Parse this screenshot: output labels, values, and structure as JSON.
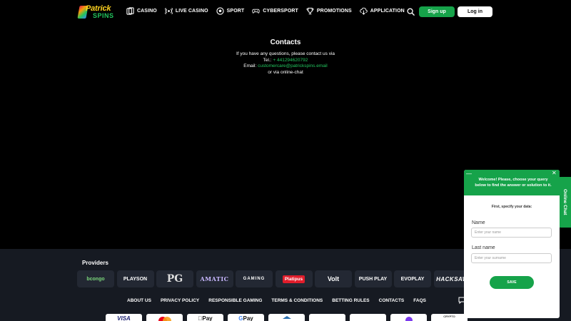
{
  "header": {
    "logo_line1": "Patrick",
    "logo_line2": "SPINS",
    "nav": [
      {
        "label": "CASINO",
        "icon": "cards-icon"
      },
      {
        "label": "LIVE CASINO",
        "icon": "broadcast-icon"
      },
      {
        "label": "SPORT",
        "icon": "soccer-ball-icon"
      },
      {
        "label": "CYBERSPORT",
        "icon": "gamepad-icon"
      },
      {
        "label": "PROMOTIONS",
        "icon": "trophy-icon"
      },
      {
        "label": "APPLICATION",
        "icon": "download-icon"
      }
    ],
    "signup_label": "Sign up",
    "login_label": "Log in"
  },
  "contacts": {
    "title": "Contacts",
    "line1": "If you have any questions, please contact us via",
    "tel_label": "Tel.:",
    "tel_value": "+ 441294620792",
    "email_label": "Email:",
    "email_value": "customercare@patrickspins.email",
    "line4": "or via online-chat"
  },
  "footer": {
    "providers_title": "Providers",
    "providers": [
      "bcongo",
      "PLAYSON",
      "PG",
      "AMATIC",
      "GAMING",
      "Platipus",
      "Volt",
      "PUSH PLAY",
      "EVOPLAY",
      "HACKSAW"
    ],
    "links": [
      "ABOUT US",
      "PRIVACY POLICY",
      "RESPONSIBLE GAMING",
      "TERMS & CONDITIONS",
      "BETTING RULES",
      "CONTACTS",
      "FAQS"
    ],
    "payments": [
      "VISA",
      "",
      "Pay",
      "Pay",
      "",
      "",
      "",
      "",
      "CRYPTO"
    ]
  },
  "chat": {
    "tab_label": "Online Chat",
    "header_text": "Welcome! Please, choose your query below to find the answer or solution to it.",
    "subtitle": "First, specify your data:",
    "name_label": "Name",
    "name_placeholder": "Enter your name",
    "lastname_label": "Last name",
    "lastname_placeholder": "Enter your surname",
    "save_label": "SAVE",
    "minimize_glyph": "—",
    "close_glyph": "✕"
  },
  "colors": {
    "accent": "#16a34a",
    "link_green": "#22c55e",
    "background": "#000000",
    "footer_bg": "#161a22"
  }
}
